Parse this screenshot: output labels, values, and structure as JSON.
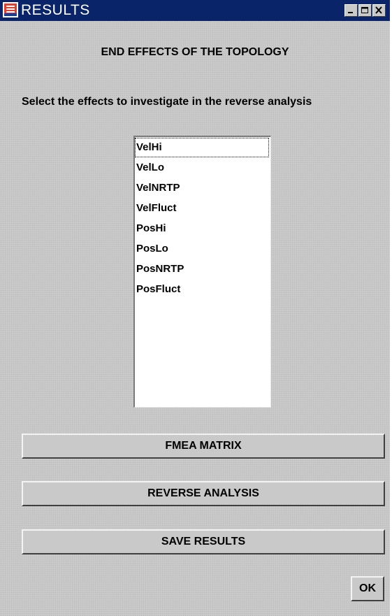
{
  "window": {
    "title": "RESULTS",
    "controls": [
      "minimize-icon",
      "maximize-icon",
      "close-icon"
    ]
  },
  "heading": "END EFFECTS OF THE TOPOLOGY",
  "instruction": "Select the effects to investigate in the reverse analysis",
  "effects": {
    "items": [
      "VelHi",
      "VelLo",
      "VelNRTP",
      "VelFluct",
      "PosHi",
      "PosLo",
      "PosNRTP",
      "PosFluct"
    ],
    "focused_item": "VelHi"
  },
  "buttons": {
    "fmea_matrix": "FMEA MATRIX",
    "reverse_analysis": "REVERSE ANALYSIS",
    "save_results": "SAVE RESULTS",
    "ok": "OK"
  },
  "colors": {
    "titlebar": "#0a246a",
    "panel": "#c9c9c9",
    "list_background": "#ffffff"
  }
}
